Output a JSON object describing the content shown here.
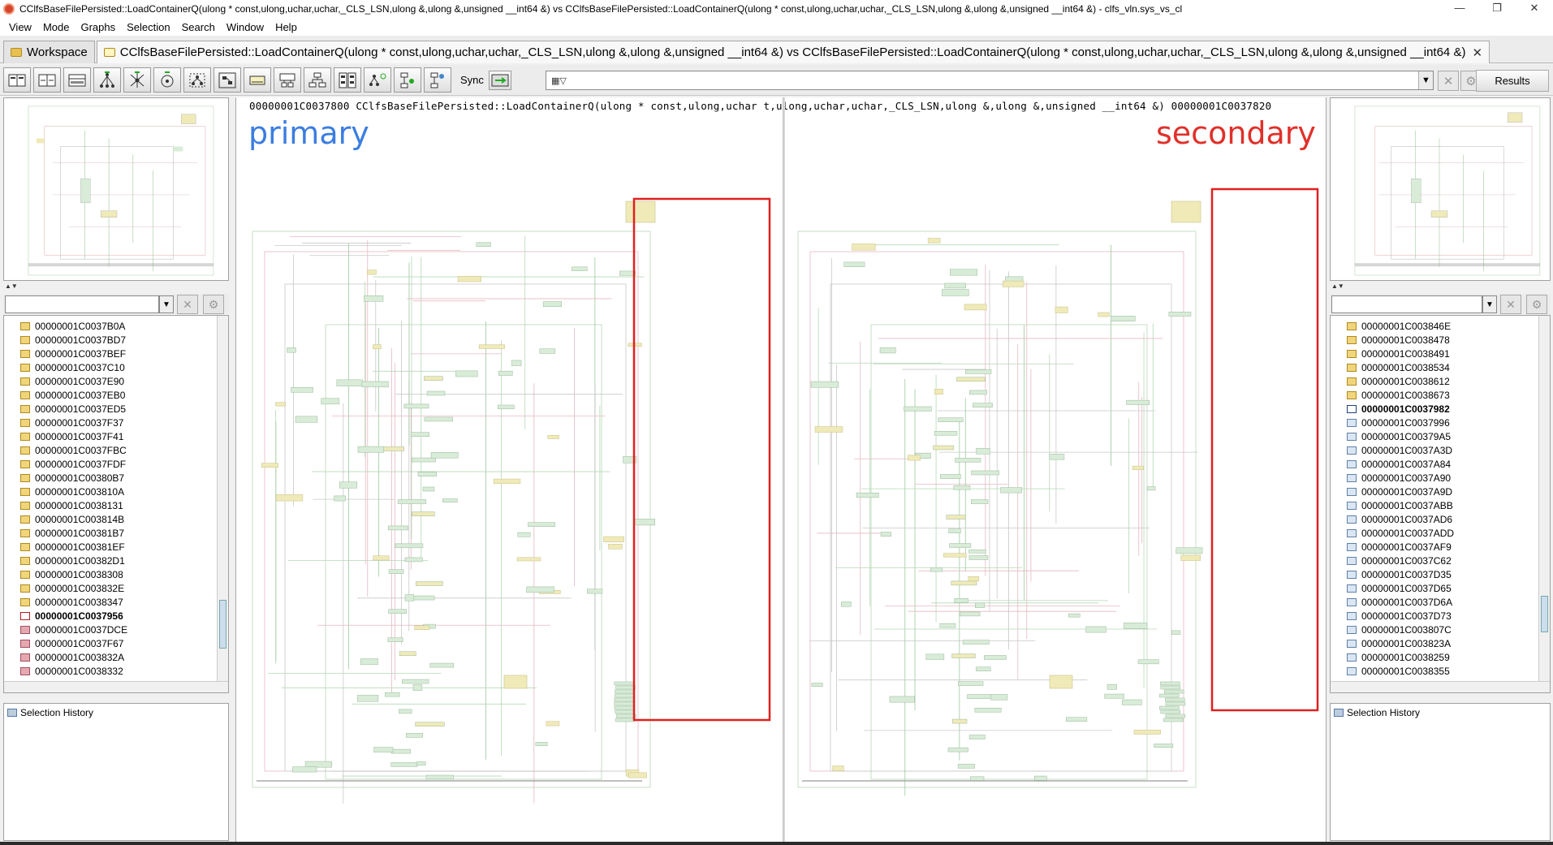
{
  "window": {
    "title": "CClfsBaseFilePersisted::LoadContainerQ(ulong * const,ulong,uchar,uchar,_CLS_LSN,ulong &,ulong &,unsigned __int64 &) vs CClfsBaseFilePersisted::LoadContainerQ(ulong * const,ulong,uchar,uchar,_CLS_LSN,ulong &,ulong &,unsigned __int64 &) - clfs_vln.sys_vs_cl",
    "minimize": "—",
    "restore": "❐",
    "close": "✕"
  },
  "menu": [
    "View",
    "Mode",
    "Graphs",
    "Selection",
    "Search",
    "Window",
    "Help"
  ],
  "tabs": {
    "workspace": "Workspace",
    "compare": "CClfsBaseFilePersisted::LoadContainerQ(ulong * const,ulong,uchar,uchar,_CLS_LSN,ulong &,ulong &,unsigned __int64 &) vs CClfsBaseFilePersisted::LoadContainerQ(ulong * const,ulong,uchar,uchar,_CLS_LSN,ulong &,ulong &,unsigned __int64 &)",
    "close": "✕"
  },
  "toolbar": {
    "sync_label": "Sync",
    "results_label": "Results",
    "combo_value": ""
  },
  "graph": {
    "header": "00000001C0037800 CClfsBaseFilePersisted::LoadContainerQ(ulong * const,ulong,uchar t,ulong,uchar,uchar,_CLS_LSN,ulong &,ulong &,unsigned __int64 &) 00000001C0037820",
    "primary_label": "primary",
    "secondary_label": "secondary",
    "primary_color": "#3b7de0",
    "secondary_color": "#e0302a",
    "highlight_color": "#e02020"
  },
  "left_list": [
    {
      "addr": "00000001C0037B0A",
      "icon": "yellow"
    },
    {
      "addr": "00000001C0037BD7",
      "icon": "yellow"
    },
    {
      "addr": "00000001C0037BEF",
      "icon": "yellow"
    },
    {
      "addr": "00000001C0037C10",
      "icon": "yellow"
    },
    {
      "addr": "00000001C0037E90",
      "icon": "yellow"
    },
    {
      "addr": "00000001C0037EB0",
      "icon": "yellow"
    },
    {
      "addr": "00000001C0037ED5",
      "icon": "yellow"
    },
    {
      "addr": "00000001C0037F37",
      "icon": "yellow"
    },
    {
      "addr": "00000001C0037F41",
      "icon": "yellow"
    },
    {
      "addr": "00000001C0037FBC",
      "icon": "yellow"
    },
    {
      "addr": "00000001C0037FDF",
      "icon": "yellow"
    },
    {
      "addr": "00000001C00380B7",
      "icon": "yellow"
    },
    {
      "addr": "00000001C003810A",
      "icon": "yellow"
    },
    {
      "addr": "00000001C0038131",
      "icon": "yellow"
    },
    {
      "addr": "00000001C003814B",
      "icon": "yellow"
    },
    {
      "addr": "00000001C00381B7",
      "icon": "yellow"
    },
    {
      "addr": "00000001C00381EF",
      "icon": "yellow"
    },
    {
      "addr": "00000001C00382D1",
      "icon": "yellow"
    },
    {
      "addr": "00000001C0038308",
      "icon": "yellow"
    },
    {
      "addr": "00000001C003832E",
      "icon": "yellow"
    },
    {
      "addr": "00000001C0038347",
      "icon": "yellow"
    },
    {
      "addr": "00000001C0037956",
      "icon": "mark",
      "bold": true
    },
    {
      "addr": "00000001C0037DCE",
      "icon": "pink"
    },
    {
      "addr": "00000001C0037F67",
      "icon": "pink"
    },
    {
      "addr": "00000001C003832A",
      "icon": "pink"
    },
    {
      "addr": "00000001C0038332",
      "icon": "pink"
    }
  ],
  "right_list": [
    {
      "addr": "00000001C003846E",
      "icon": "yellow"
    },
    {
      "addr": "00000001C0038478",
      "icon": "yellow"
    },
    {
      "addr": "00000001C0038491",
      "icon": "yellow"
    },
    {
      "addr": "00000001C0038534",
      "icon": "yellow"
    },
    {
      "addr": "00000001C0038612",
      "icon": "yellow"
    },
    {
      "addr": "00000001C0038673",
      "icon": "yellow"
    },
    {
      "addr": "00000001C0037982",
      "icon": "mark2",
      "bold": true
    },
    {
      "addr": "00000001C0037996",
      "icon": "blue"
    },
    {
      "addr": "00000001C00379A5",
      "icon": "blue"
    },
    {
      "addr": "00000001C0037A3D",
      "icon": "blue"
    },
    {
      "addr": "00000001C0037A84",
      "icon": "blue"
    },
    {
      "addr": "00000001C0037A90",
      "icon": "blue"
    },
    {
      "addr": "00000001C0037A9D",
      "icon": "blue"
    },
    {
      "addr": "00000001C0037ABB",
      "icon": "blue"
    },
    {
      "addr": "00000001C0037AD6",
      "icon": "blue"
    },
    {
      "addr": "00000001C0037ADD",
      "icon": "blue"
    },
    {
      "addr": "00000001C0037AF9",
      "icon": "blue"
    },
    {
      "addr": "00000001C0037C62",
      "icon": "blue"
    },
    {
      "addr": "00000001C0037D35",
      "icon": "blue"
    },
    {
      "addr": "00000001C0037D65",
      "icon": "blue"
    },
    {
      "addr": "00000001C0037D6A",
      "icon": "blue"
    },
    {
      "addr": "00000001C0037D73",
      "icon": "blue"
    },
    {
      "addr": "00000001C003807C",
      "icon": "blue"
    },
    {
      "addr": "00000001C003823A",
      "icon": "blue"
    },
    {
      "addr": "00000001C0038259",
      "icon": "blue"
    },
    {
      "addr": "00000001C0038355",
      "icon": "blue"
    }
  ],
  "history": {
    "left_title": "Selection History",
    "right_title": "Selection History"
  }
}
